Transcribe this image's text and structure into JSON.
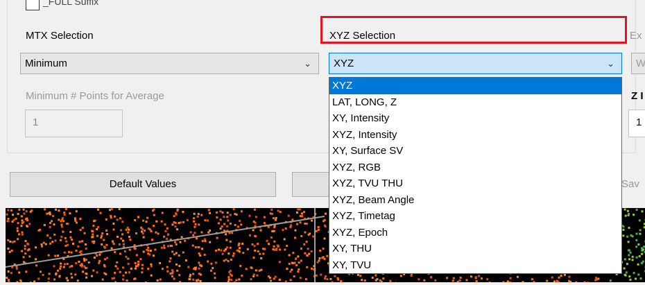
{
  "full_suffix": {
    "label": "_FULL Suffix",
    "checked": false
  },
  "mtx": {
    "label": "MTX Selection",
    "value": "Minimum"
  },
  "min_points": {
    "label": "Minimum # Points for Average",
    "value": "1"
  },
  "xyz": {
    "label": "XYZ Selection",
    "value": "XYZ",
    "options": [
      "XYZ",
      "LAT, LONG, Z",
      "XY, Intensity",
      "XYZ, Intensity",
      "XY, Surface SV",
      "XYZ, RGB",
      "XYZ, TVU THU",
      "XYZ, Beam Angle",
      "XYZ, Timetag",
      "XYZ, Epoch",
      "XY, THU",
      "XY, TVU"
    ],
    "selected_index": 0
  },
  "clipped_right": {
    "ex_label": "Ex",
    "w_value": "W",
    "z_label": "Z I",
    "z_value": "1",
    "save_label": "Sav"
  },
  "buttons": {
    "default_values": "Default Values"
  },
  "colors": {
    "highlight": "#e81123",
    "selection": "#0078d7",
    "combo_focus": "#cce4f7"
  }
}
